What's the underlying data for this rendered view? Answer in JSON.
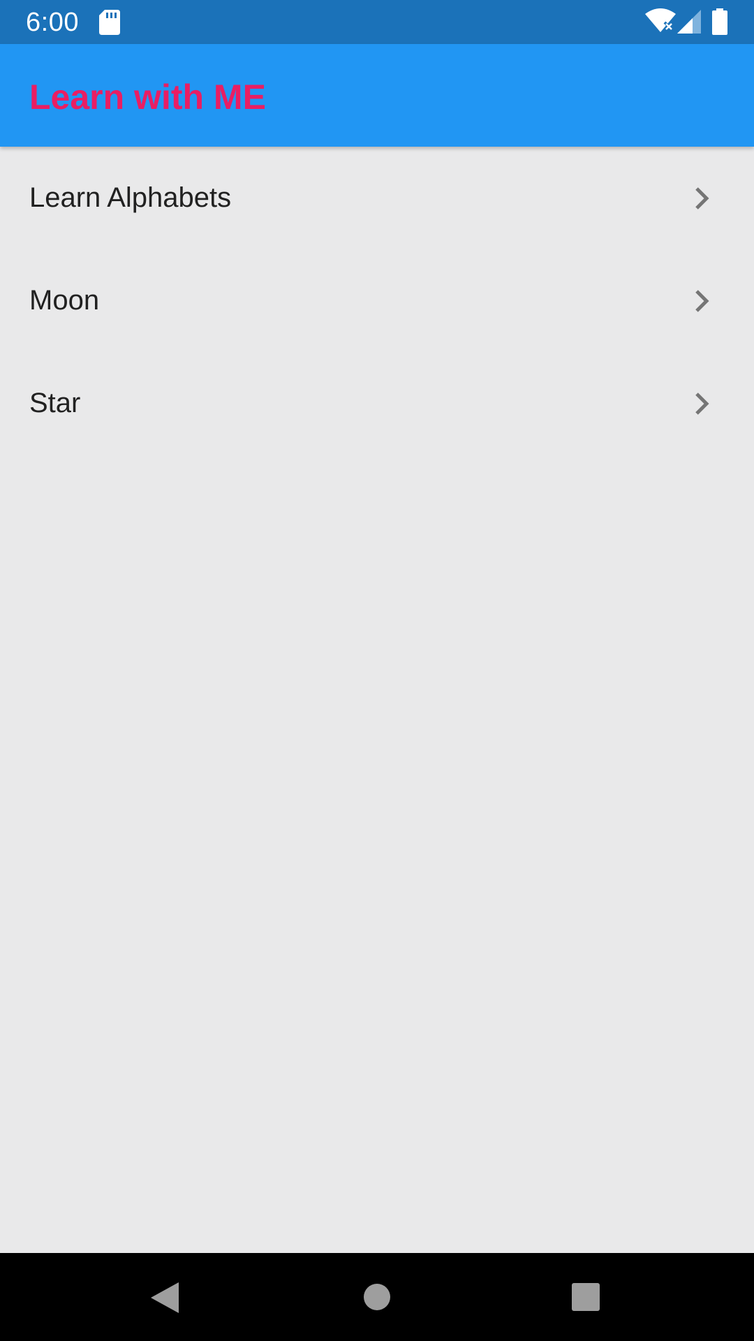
{
  "status_bar": {
    "time": "6:00",
    "icons": [
      "sd-card-icon",
      "wifi-icon",
      "cell-signal-icon",
      "battery-icon"
    ]
  },
  "app_bar": {
    "title": "Learn with ME",
    "background_color": "#2196f3",
    "title_color": "#e91e63"
  },
  "list": {
    "items": [
      {
        "label": "Learn Alphabets",
        "icon": "chevron-right-icon"
      },
      {
        "label": "Moon",
        "icon": "chevron-right-icon"
      },
      {
        "label": "Star",
        "icon": "chevron-right-icon"
      }
    ]
  },
  "nav_bar": {
    "buttons": [
      "back-icon",
      "home-icon",
      "recents-icon"
    ]
  },
  "colors": {
    "status_bar": "#1b72b9",
    "background": "#e9e9ea",
    "text": "#212121",
    "chevron": "#757575"
  }
}
